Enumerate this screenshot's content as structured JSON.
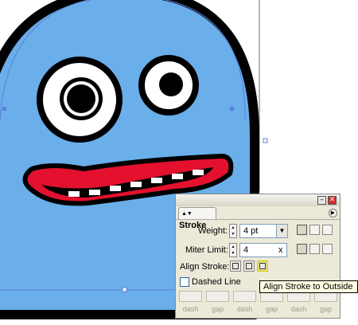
{
  "colors": {
    "creature_body": "#6aaeea",
    "outline": "#000000",
    "mouth": "#e3102e",
    "selection": "#5b7fd8"
  },
  "stroke_panel": {
    "tab_label": "Stroke",
    "weight_label": "Weight:",
    "weight_value": "4 pt",
    "miter_label": "Miter Limit:",
    "miter_value": "4",
    "miter_unit": "x",
    "align_label": "Align Stroke:",
    "dashed_label": "Dashed Line",
    "dash_labels": [
      "dash",
      "gap",
      "dash",
      "gap",
      "dash",
      "gap"
    ],
    "cap_icons": [
      "butt-cap-icon",
      "round-cap-icon",
      "projecting-cap-icon"
    ],
    "join_icons": [
      "miter-join-icon",
      "round-join-icon",
      "bevel-join-icon"
    ],
    "align_icons": [
      "align-center-icon",
      "align-inside-icon",
      "align-outside-icon"
    ],
    "selected_align": "align-outside"
  },
  "tooltip": "Align Stroke to Outside"
}
